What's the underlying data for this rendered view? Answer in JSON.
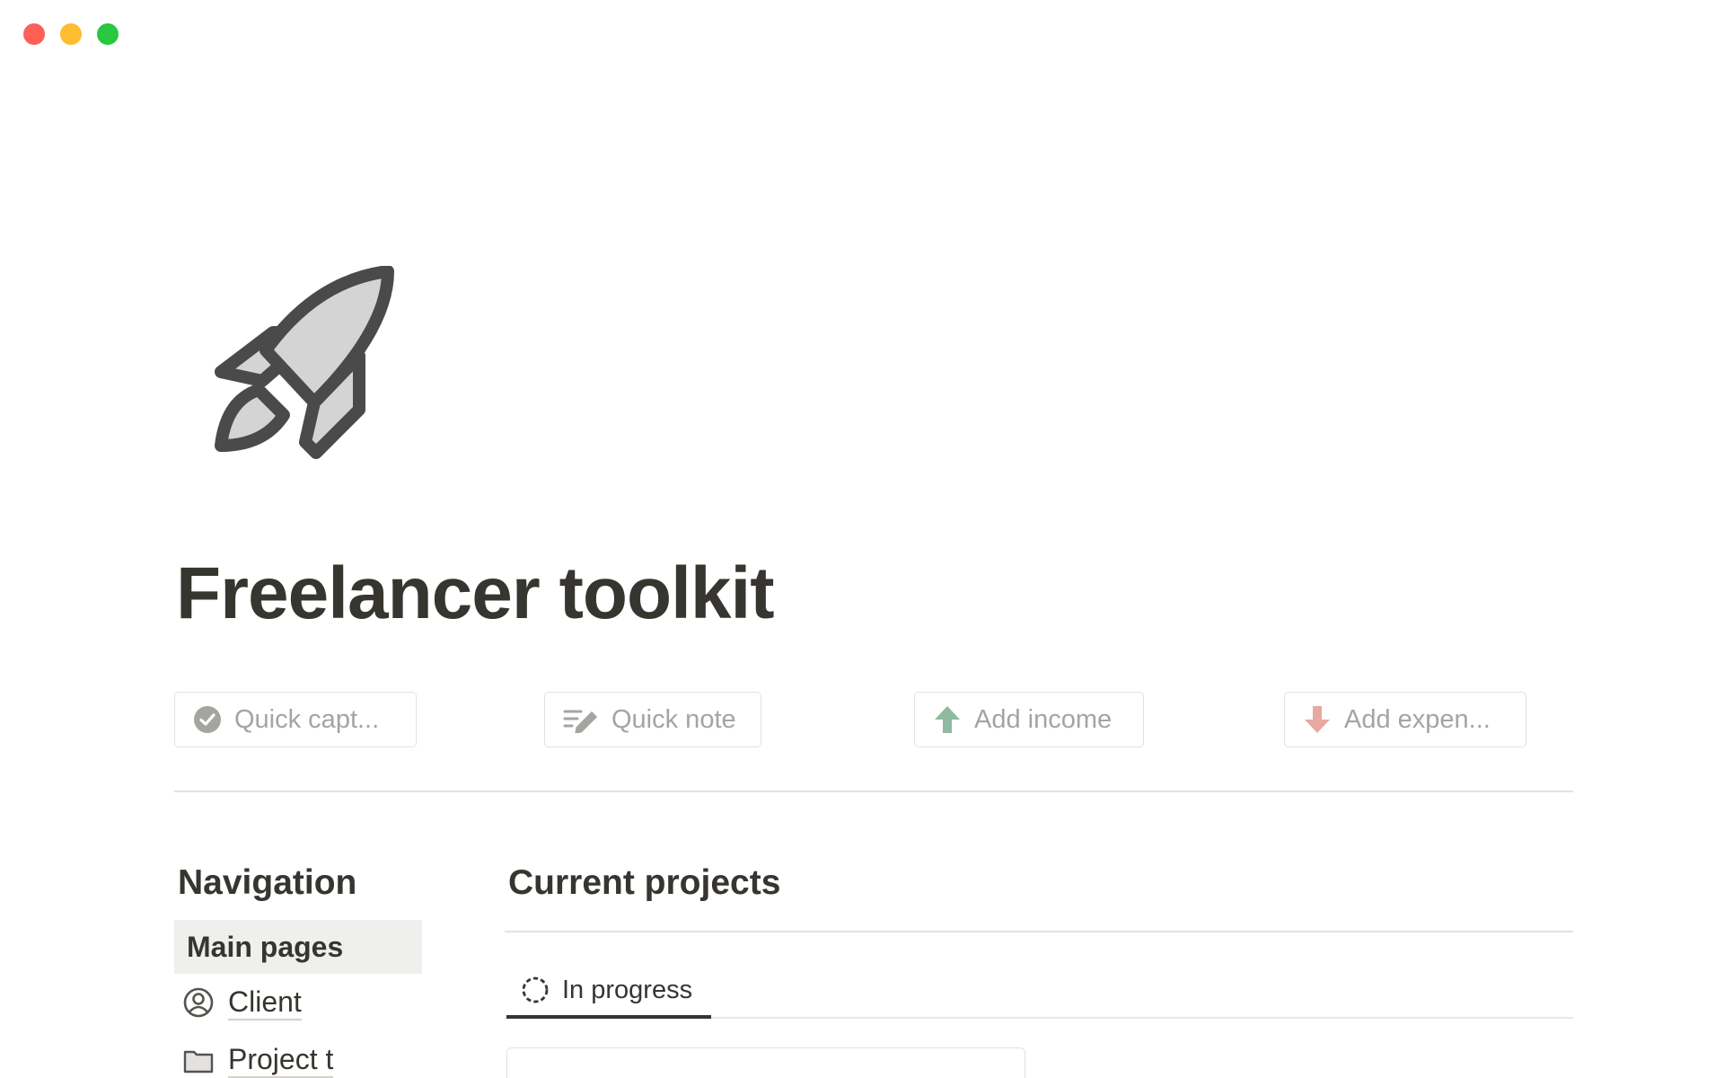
{
  "window": {
    "controls": [
      "close",
      "minimize",
      "zoom"
    ]
  },
  "page": {
    "icon": "rocket-icon",
    "title": "Freelancer toolkit"
  },
  "actions": [
    {
      "label": "Quick capt...",
      "icon": "check-circle-icon",
      "color": "#a5a4a1"
    },
    {
      "label": "Quick note",
      "icon": "note-edit-icon",
      "color": "#a5a4a1"
    },
    {
      "label": "Add income",
      "icon": "arrow-up-icon",
      "color": "#8fb9a0"
    },
    {
      "label": "Add expen...",
      "icon": "arrow-down-icon",
      "color": "#e6a9a3"
    }
  ],
  "navigation": {
    "heading": "Navigation",
    "group_label": "Main pages",
    "items": [
      {
        "label": "Client",
        "icon": "user-circle-icon"
      },
      {
        "label": "Project t",
        "icon": "folder-icon"
      }
    ]
  },
  "projects": {
    "heading": "Current projects",
    "tabs": [
      {
        "label": "In progress",
        "icon": "dashed-circle-icon",
        "active": true
      }
    ]
  }
}
